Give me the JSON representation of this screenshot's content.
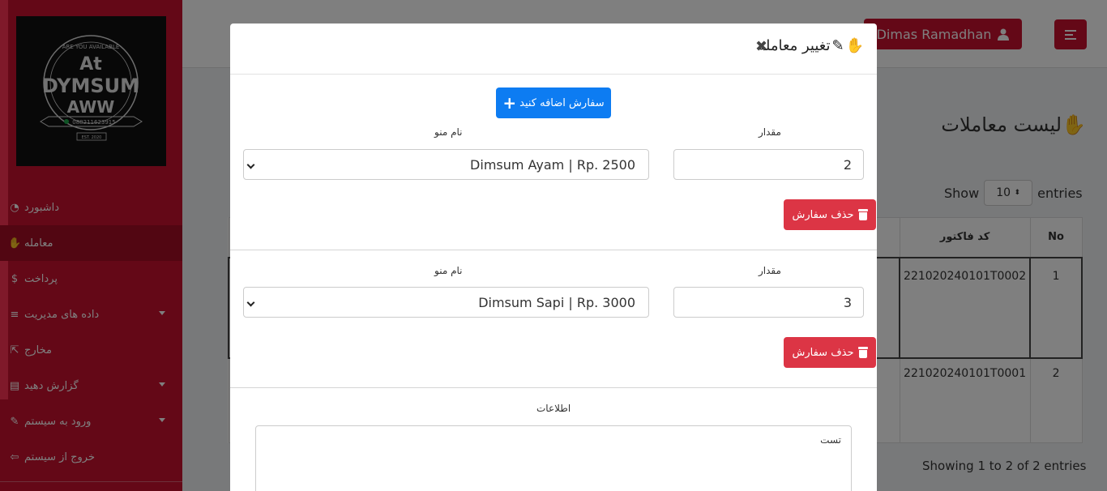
{
  "sidebar": {
    "logo_text": {
      "arc": "ARE YOU AVAILABLE",
      "line1": "At",
      "line2": "DYMSUM",
      "line3": "AWW",
      "phone": "088211623915",
      "est": "EST. 2020"
    },
    "items": [
      {
        "label": "داشبورد",
        "icon": "dashboard-icon",
        "glyph": "◔"
      },
      {
        "label": "معامله",
        "icon": "handshake-icon",
        "glyph": "✋"
      },
      {
        "label": "پرداخت",
        "icon": "dollar-icon",
        "glyph": "$"
      },
      {
        "label": "داده های مدیریت",
        "icon": "list-icon",
        "glyph": "≡"
      },
      {
        "label": "مخارج",
        "icon": "share-icon",
        "glyph": "⇱"
      },
      {
        "label": "گزارش دهید",
        "icon": "pdf-file-icon",
        "glyph": "▤"
      },
      {
        "label": "ورود به سیستم",
        "icon": "signature-icon",
        "glyph": "✎"
      },
      {
        "label": "خروج از سیستم",
        "icon": "sign-out-icon",
        "glyph": "⇦"
      }
    ]
  },
  "topbar": {
    "user_name": "Dimas Ramadhan",
    "user_icon": "user-icon"
  },
  "content": {
    "title": "لیست معاملات",
    "show_label": "Show",
    "entries_value": "10",
    "entries_label": "entries",
    "table_headers": {
      "no": "No",
      "invoice": "کد فاکتور"
    },
    "rows": [
      {
        "no": "1",
        "invoice": "221020240101T0002"
      },
      {
        "no": "2",
        "invoice": "221020240101T0001"
      }
    ],
    "info": "Showing 1 to 2 of 2 entries"
  },
  "modal": {
    "title": "تغییر معامله",
    "close_glyph": "✖",
    "add_button": "سفارش اضافه کنید",
    "orders": [
      {
        "qty_label": "مقدار",
        "qty_value": "2",
        "menu_label": "نام منو",
        "menu_value": "Dimsum Ayam | Rp. 2500",
        "delete_label": "حذف سفارش"
      },
      {
        "qty_label": "مقدار",
        "qty_value": "3",
        "menu_label": "نام منو",
        "menu_value": "Dimsum Sapi | Rp. 3000",
        "delete_label": "حذف سفارش"
      }
    ],
    "info_label": "اطلاعات",
    "info_value": "تست"
  },
  "colors": {
    "brand_red": "#c8102e",
    "primary_blue": "#0d7cf2",
    "danger_red": "#dc3545"
  }
}
